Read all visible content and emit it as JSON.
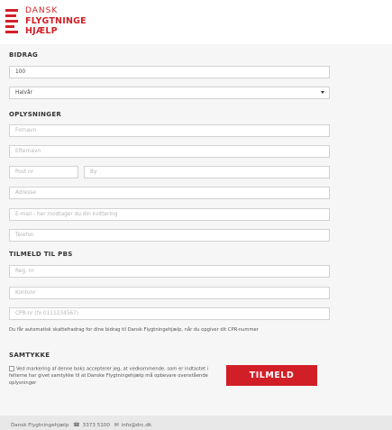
{
  "brand": {
    "lines": [
      "DANSK",
      "FLYGTNINGE",
      "HJÆLP"
    ],
    "color": "#d21f27"
  },
  "sections": {
    "bidrag": "BIDRAG",
    "oplysninger": "OPLYSNINGER",
    "pbs": "TILMELD TIL PBS",
    "samtykke": "SAMTYKKE"
  },
  "bidrag": {
    "amount_value": "100",
    "frequency_selected": "Halvår"
  },
  "oplysninger": {
    "fornavn_placeholder": "Fornavn",
    "efternavn_placeholder": "Efternavn",
    "postnr_placeholder": "Post nr",
    "by_placeholder": "By",
    "adresse_placeholder": "Adresse",
    "email_placeholder": "E-mail - her modtager du din kvittering",
    "telefon_placeholder": "Telefon"
  },
  "pbs": {
    "regnr_placeholder": "Reg. nr",
    "kontonr_placeholder": "Kontonr",
    "cpr_placeholder": "CPR-nr (fx 0111234567)"
  },
  "info_text": "Du får automatisk skattefradrag for dine bidrag til Dansk Flygtningehjælp, når du opgiver dit CPR-nummer",
  "samtykke": {
    "text": "Ved markering af denne boks accepterer jeg, at vedkommende, som er indtastet i felterne har givet samtykke til at Danske Flygtningehjælp må opbevare ovenstående oplysninger"
  },
  "submit_label": "TILMELD",
  "footer": {
    "org": "Dansk Flygtningehjælp",
    "phone": "3373 5100",
    "email": "info@drc.dk"
  }
}
